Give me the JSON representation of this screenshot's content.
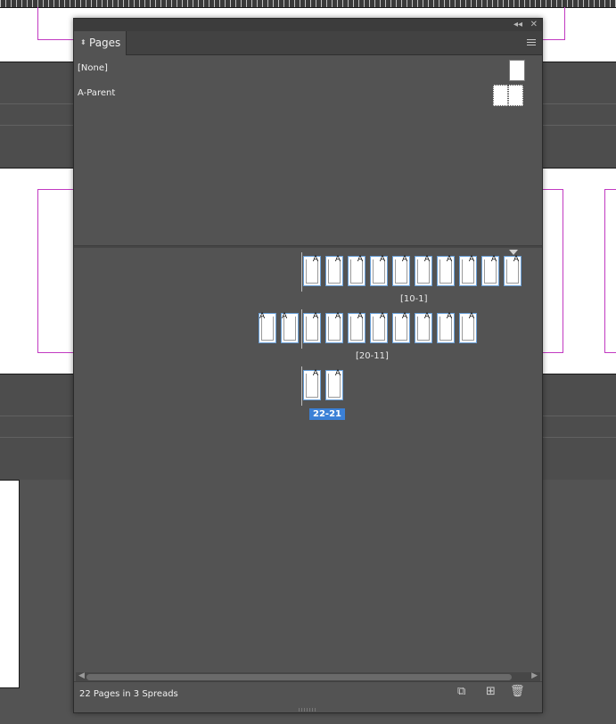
{
  "panel": {
    "tab_label": "Pages",
    "parents": [
      {
        "name": "[None]"
      },
      {
        "name": "A-Parent"
      }
    ],
    "spreads": [
      {
        "label": "[10-1]",
        "pages": [
          "A",
          "A",
          "A",
          "A",
          "A",
          "A",
          "A",
          "A",
          "A",
          "A"
        ]
      },
      {
        "label": "[20-11]",
        "pages": [
          "A",
          "A",
          "A",
          "A",
          "A",
          "A",
          "A",
          "A",
          "A",
          "A"
        ]
      },
      {
        "label": "22-21",
        "pages": [
          "A",
          "A"
        ],
        "selected": true
      }
    ],
    "status_text": "22 Pages in 3 Spreads",
    "icons": {
      "collapse": "double-chevron-left-icon",
      "close": "close-icon",
      "menu": "panel-menu-icon",
      "edit_page_size": "edit-page-size-icon",
      "new_page": "new-page-icon",
      "delete": "trash-icon"
    }
  }
}
